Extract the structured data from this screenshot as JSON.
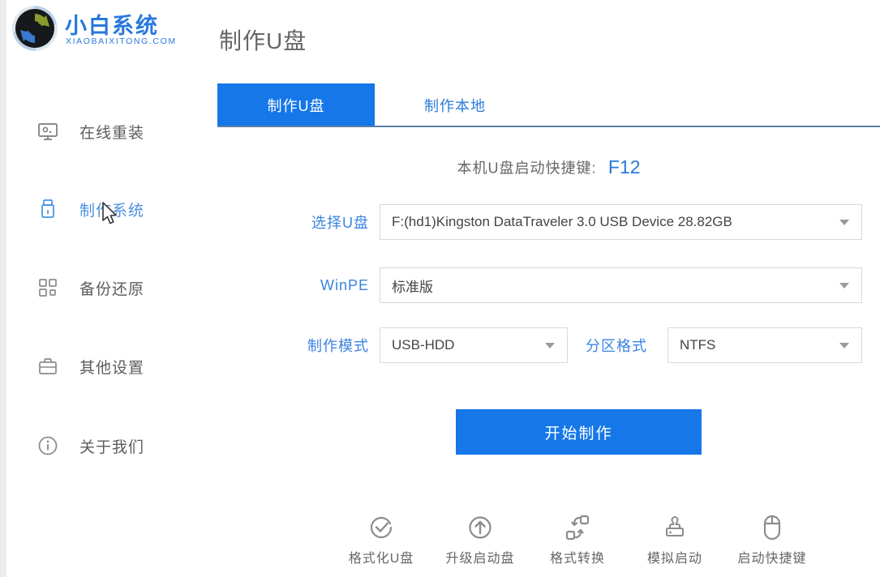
{
  "brand": {
    "name": "小白系统",
    "domain": "XIAOBAIXITONG.COM"
  },
  "header": {
    "page_title": "制作U盘"
  },
  "sidebar": {
    "items": [
      {
        "label": "在线重装",
        "icon": "monitor-icon",
        "active": false
      },
      {
        "label": "制作系统",
        "icon": "usb-drive-icon",
        "active": true
      },
      {
        "label": "备份还原",
        "icon": "backup-restore-icon",
        "active": false
      },
      {
        "label": "其他设置",
        "icon": "briefcase-icon",
        "active": false
      },
      {
        "label": "关于我们",
        "icon": "info-icon",
        "active": false
      }
    ]
  },
  "tabs": {
    "make_usb": "制作U盘",
    "make_local": "制作本地"
  },
  "content": {
    "hotkey_label": "本机U盘启动快捷键:",
    "hotkey_value": "F12",
    "fields": {
      "usb": {
        "label": "选择U盘",
        "value": "F:(hd1)Kingston DataTraveler 3.0 USB Device 28.82GB"
      },
      "winpe": {
        "label": "WinPE",
        "value": "标准版"
      },
      "mode": {
        "label": "制作模式",
        "value": "USB-HDD"
      },
      "partition": {
        "label": "分区格式",
        "value": "NTFS"
      }
    },
    "start_button": "开始制作"
  },
  "toolbar": {
    "items": [
      {
        "label": "格式化U盘",
        "icon": "format-usb-icon"
      },
      {
        "label": "升级启动盘",
        "icon": "upgrade-boot-icon"
      },
      {
        "label": "格式转换",
        "icon": "format-convert-icon"
      },
      {
        "label": "模拟启动",
        "icon": "simulate-boot-icon"
      },
      {
        "label": "启动快捷键",
        "icon": "boot-hotkey-icon"
      }
    ]
  },
  "colors": {
    "primary": "#1677e8",
    "link_blue": "#2d7cd9",
    "sidebar_active": "#4a90e2",
    "label_blue": "#3a83e0"
  }
}
